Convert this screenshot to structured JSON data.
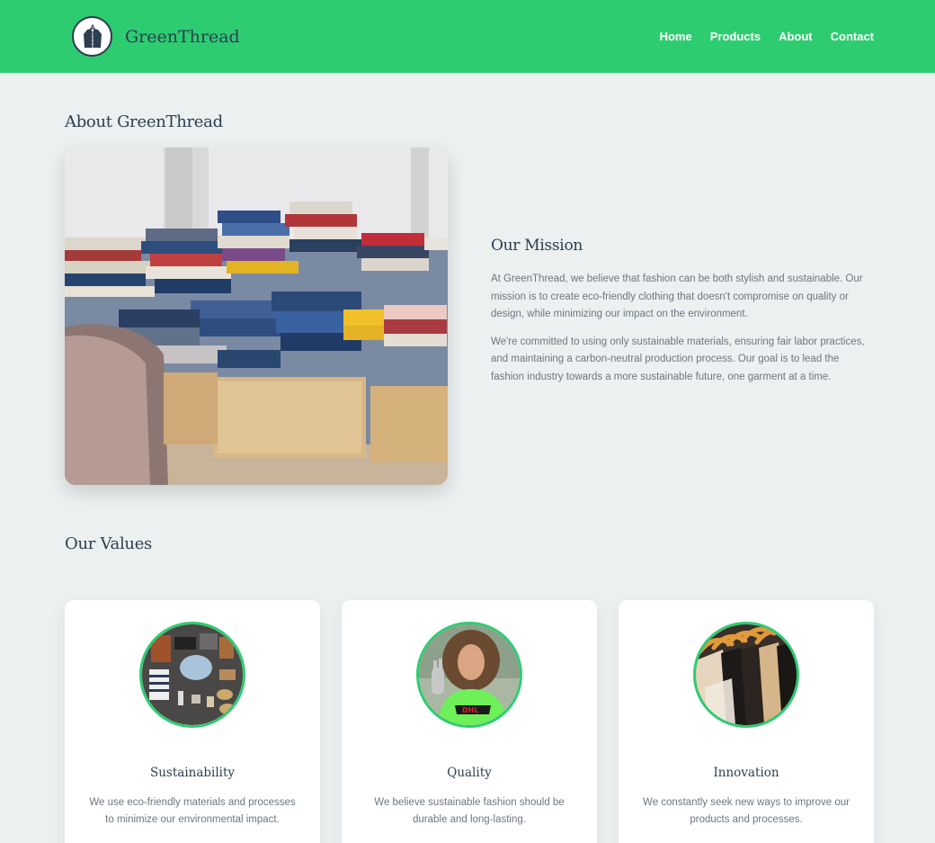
{
  "header": {
    "brand": "GreenThread",
    "logo_icon": "jacket-logo-icon",
    "nav": [
      {
        "label": "Home"
      },
      {
        "label": "Products"
      },
      {
        "label": "About"
      },
      {
        "label": "Contact"
      }
    ]
  },
  "about": {
    "title": "About GreenThread",
    "image_icon": "clothing-piles-photo",
    "mission_title": "Our Mission",
    "paragraphs": [
      "At GreenThread, we believe that fashion can be both stylish and sustainable. Our mission is to create eco-friendly clothing that doesn't compromise on quality or design, while minimizing our impact on the environment.",
      "We're committed to using only sustainable materials, ensuring fair labor practices, and maintaining a carbon-neutral production process. Our goal is to lead the fashion industry towards a more sustainable future, one garment at a time."
    ]
  },
  "values": {
    "title": "Our Values",
    "cards": [
      {
        "title": "Sustainability",
        "text": "We use eco-friendly materials and processes to minimize our environmental impact.",
        "image_icon": "flatlay-outfit-photo"
      },
      {
        "title": "Quality",
        "text": "We believe sustainable fashion should be durable and long-lasting.",
        "image_icon": "woman-portrait-photo"
      },
      {
        "title": "Innovation",
        "text": "We constantly seek new ways to improve our products and processes.",
        "image_icon": "hangers-rack-photo"
      }
    ]
  },
  "colors": {
    "accent": "#2ecc71",
    "text": "#2c3e50",
    "background": "#ecf0f1",
    "muted": "#6b7780"
  }
}
